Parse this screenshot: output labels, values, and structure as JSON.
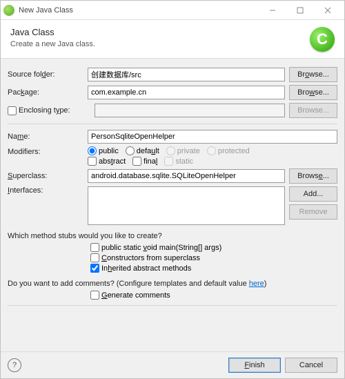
{
  "titlebar": {
    "title": "New Java Class"
  },
  "header": {
    "title": "Java Class",
    "subtitle": "Create a new Java class.",
    "icon_letter": "C"
  },
  "labels": {
    "source_folder": "Source folder:",
    "package": "Package:",
    "enclosing": "Enclosing type:",
    "name": "Name:",
    "modifiers": "Modifiers:",
    "superclass": "Superclass:",
    "interfaces": "Interfaces:"
  },
  "fields": {
    "source_folder": "创建数据库/src",
    "package": "com.example.cn",
    "enclosing": "",
    "name": "PersonSqliteOpenHelper",
    "superclass": "android.database.sqlite.SQLiteOpenHelper"
  },
  "modifiers": {
    "public": "public",
    "default": "default",
    "private": "private",
    "protected": "protected",
    "abstract": "abstract",
    "final": "final",
    "static": "static"
  },
  "buttons": {
    "browse": "Browse...",
    "add": "Add...",
    "remove": "Remove",
    "finish": "Finish",
    "cancel": "Cancel"
  },
  "method_stubs": {
    "question": "Which method stubs would you like to create?",
    "main": "public static void main(String[] args)",
    "constructors": "Constructors from superclass",
    "inherited": "Inherited abstract methods"
  },
  "comments": {
    "question_prefix": "Do you want to add comments? (Configure templates and default value ",
    "link": "here",
    "question_suffix": ")",
    "checkbox": "Generate comments"
  }
}
